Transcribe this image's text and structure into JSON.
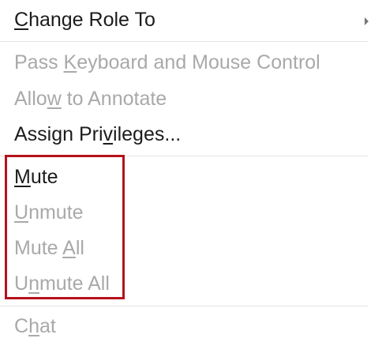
{
  "menu": {
    "items": [
      {
        "pre": "",
        "acc": "C",
        "post": "hange Role To",
        "enabled": true,
        "submenu": true
      },
      {
        "pre": "Pass ",
        "acc": "K",
        "post": "eyboard and Mouse Control",
        "enabled": false
      },
      {
        "pre": "Allo",
        "acc": "w",
        "post": " to Annotate",
        "enabled": false
      },
      {
        "pre": "Assign Pri",
        "acc": "v",
        "post": "ileges...",
        "enabled": true
      },
      {
        "pre": "",
        "acc": "M",
        "post": "ute",
        "enabled": true
      },
      {
        "pre": "",
        "acc": "U",
        "post": "nmute",
        "enabled": false
      },
      {
        "pre": "Mute ",
        "acc": "A",
        "post": "ll",
        "enabled": false
      },
      {
        "pre": "U",
        "acc": "n",
        "post": "mute All",
        "enabled": false
      },
      {
        "pre": "C",
        "acc": "h",
        "post": "at",
        "enabled": false
      }
    ]
  },
  "icons": {
    "submenu_arrow": "chevron-right-icon"
  },
  "colors": {
    "enabled_text": "#1c1c1c",
    "disabled_text": "#a9a9a9",
    "separator": "#e3e3e3",
    "highlight": "#b5121b"
  }
}
